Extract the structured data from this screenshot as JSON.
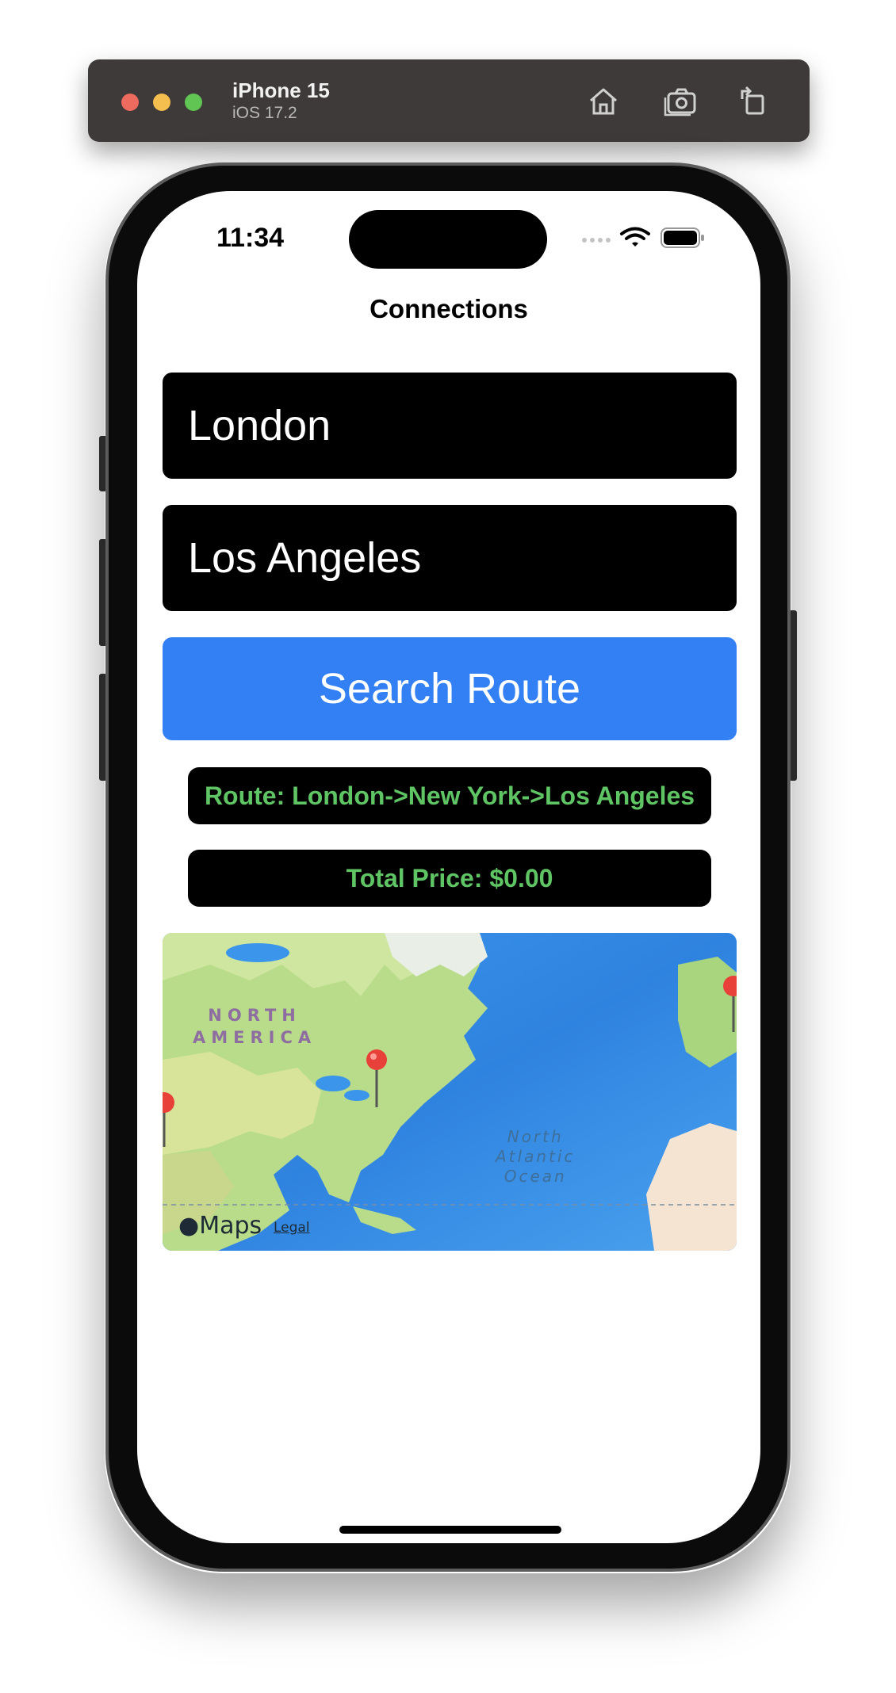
{
  "simulator": {
    "device_name": "iPhone 15",
    "os_version": "iOS 17.2",
    "toolbar_icons": [
      "home-icon",
      "screenshot-icon",
      "rotate-icon"
    ]
  },
  "status_bar": {
    "time": "11:34",
    "icons": [
      "cellular-dots-icon",
      "wifi-icon",
      "battery-icon"
    ]
  },
  "nav": {
    "title": "Connections"
  },
  "form": {
    "from_value": "London",
    "to_value": "Los Angeles",
    "search_button_label": "Search Route"
  },
  "results": {
    "route_text": "Route: London->New York->Los Angeles",
    "price_text": "Total Price: $0.00"
  },
  "map": {
    "continent_label_line1": "NORTH",
    "continent_label_line2": "AMERICA",
    "ocean_label_line1": "North",
    "ocean_label_line2": "Atlantic",
    "ocean_label_line3": "Ocean",
    "attribution": "Maps",
    "legal_link": "Legal",
    "pins": [
      "London",
      "New York",
      "Los Angeles"
    ]
  },
  "colors": {
    "accent_blue": "#3380f5",
    "result_text_green": "#5fc463",
    "pin_red": "#e8413a"
  }
}
